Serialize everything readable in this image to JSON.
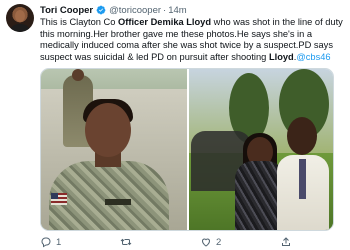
{
  "author": {
    "name": "Tori Cooper",
    "handle": "@toricooper",
    "separator": "·",
    "time": "14m"
  },
  "tweet": {
    "segments": [
      {
        "text": "This is Clayton Co ",
        "style": "normal"
      },
      {
        "text": "Officer Demika Lloyd",
        "style": "bold"
      },
      {
        "text": " who was shot in the line of duty this morning.Her brother gave me these photos.He says she's in a medically induced coma after she was shot twice by a suspect.PD says suspect was suicidal & led PD on pursuit after shooting ",
        "style": "normal"
      },
      {
        "text": "Lloyd",
        "style": "bold"
      },
      {
        "text": ".",
        "style": "normal"
      },
      {
        "text": "@cbs46",
        "style": "mention"
      }
    ]
  },
  "actions": {
    "reply_count": "1",
    "retweet_count": "",
    "like_count": "2",
    "share_count": ""
  },
  "colors": {
    "verified": "#1d9bf0",
    "mention": "#1d9bf0",
    "icon": "#536471"
  },
  "icons": [
    "verified-badge-icon",
    "reply-icon",
    "retweet-icon",
    "like-icon",
    "share-icon"
  ]
}
